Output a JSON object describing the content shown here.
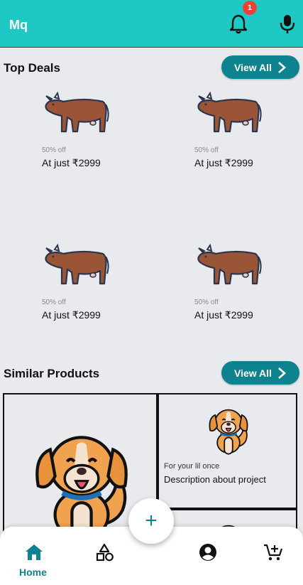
{
  "appbar": {
    "brand": "Mq",
    "notification_count": "1"
  },
  "top_deals": {
    "title": "Top Deals",
    "view_all": "View All",
    "items": [
      {
        "discount": "50% off",
        "price": "At just ₹2999"
      },
      {
        "discount": "50% off",
        "price": "At just ₹2999"
      },
      {
        "discount": "50% off",
        "price": "At just ₹2999"
      },
      {
        "discount": "50% off",
        "price": "At just ₹2999"
      }
    ]
  },
  "similar_products": {
    "title": "Similar Products",
    "view_all": "View All",
    "card": {
      "subtitle": "For your lil once",
      "description": "Description about project"
    }
  },
  "fab": {
    "label": "+"
  },
  "bottom_nav": {
    "home_label": "Home"
  },
  "colors": {
    "appbar": "#1ec8c4",
    "accent": "#0e8390",
    "badge": "#ea4335",
    "background": "#e9eaed"
  }
}
